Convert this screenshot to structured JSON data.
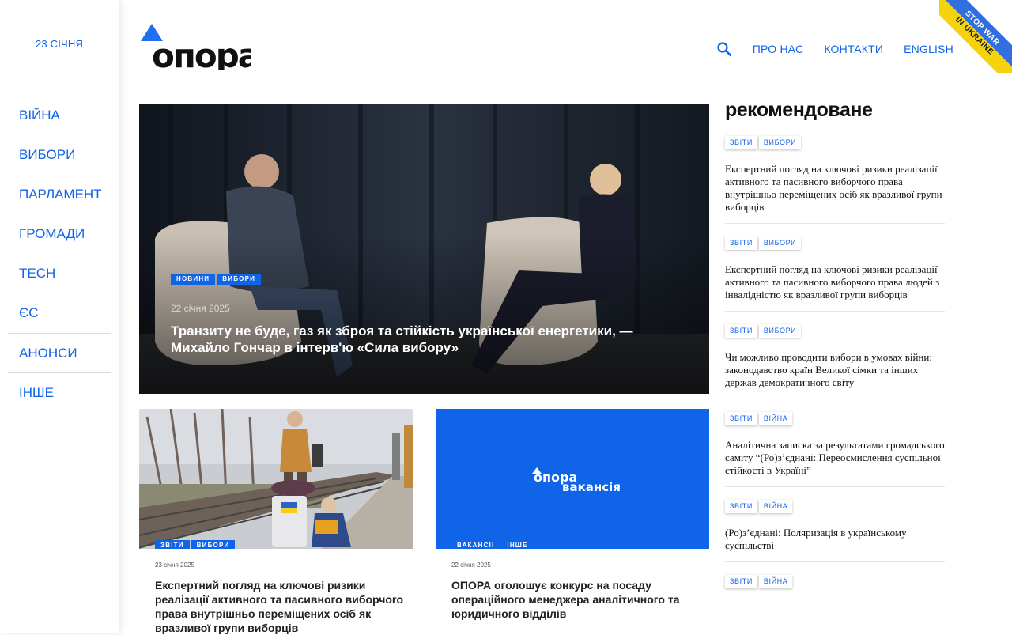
{
  "sidebar": {
    "date": "23 СІЧНЯ",
    "items": [
      {
        "label": "ВІЙНА"
      },
      {
        "label": "ВИБОРИ"
      },
      {
        "label": "ПАРЛАМЕНТ"
      },
      {
        "label": "ГРОМАДИ"
      },
      {
        "label": "TECH"
      },
      {
        "label": "ЄС"
      },
      {
        "label": "АНОНСИ"
      },
      {
        "label": "ІНШЕ"
      }
    ]
  },
  "header": {
    "logo_text": "опора",
    "nav": {
      "about": "ПРО НАС",
      "contacts": "КОНТАКТИ",
      "english": "ENGLISH"
    },
    "ribbon": {
      "line1": "STOP WAR",
      "line2": "IN UKRAINE"
    }
  },
  "hero": {
    "tags": [
      "НОВИНИ",
      "ВИБОРИ"
    ],
    "date": "22 січня 2025",
    "title": "Транзиту не буде, газ як зброя та стійкість української енергетики, — Михайло Гончар в інтерв'ю «Сила вибору»"
  },
  "cards": [
    {
      "tags": [
        "ЗВІТИ",
        "ВИБОРИ"
      ],
      "date": "23 січня 2025",
      "title": "Експертний погляд на ключові ризики реалізації активного та пасивного виборчого права внутрішньо переміщених осіб як вразливої групи виборців"
    },
    {
      "tags": [
        "ВАКАНСІЇ",
        "ІНШЕ"
      ],
      "date": "22 січня 2025",
      "title": "ОПОРА оголошує конкурс на посаду операційного менеджера аналітичного та юридичного відділів",
      "image_text": {
        "brand": "опора",
        "word": "вакансія"
      }
    }
  ],
  "recommended": {
    "heading": "рекомендоване",
    "items": [
      {
        "tags": [
          "ЗВІТИ",
          "ВИБОРИ"
        ],
        "title": "Експертний погляд на ключові ризики реалізації активного та пасивного виборчого права внутрішньо переміщених осіб як вразливої групи виборців"
      },
      {
        "tags": [
          "ЗВІТИ",
          "ВИБОРИ"
        ],
        "title": "Експертний погляд на ключові ризики реалізації активного та пасивного виборчого права людей з інвалідністю як вразливої групи виборців"
      },
      {
        "tags": [
          "ЗВІТИ",
          "ВИБОРИ"
        ],
        "title": "Чи можливо проводити вибори в умовах війни: законодавство країн Великої сімки та інших держав демократичного світу"
      },
      {
        "tags": [
          "ЗВІТИ",
          "ВІЙНА"
        ],
        "title": "Аналітична записка за результатами громадського саміту “(Ро)з’єднані: Переосмислення суспільної стійкості в Україні”"
      },
      {
        "tags": [
          "ЗВІТИ",
          "ВІЙНА"
        ],
        "title": "(Ро)з’єднані: Поляризація в українському суспільстві"
      },
      {
        "tags": [
          "ЗВІТИ",
          "ВІЙНА"
        ],
        "title": ""
      }
    ]
  },
  "colors": {
    "accent": "#1064e8",
    "ribbon_blue": "#2f6fe0",
    "ribbon_yellow": "#f5d20e"
  }
}
